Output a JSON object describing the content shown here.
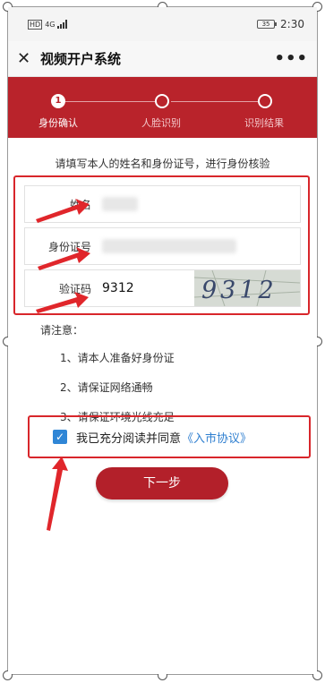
{
  "status_bar": {
    "network_badge": "HD",
    "network_type": "4G",
    "battery_level": "35",
    "time": "2:30"
  },
  "nav": {
    "close_icon": "close-icon",
    "title": "视频开户系统",
    "more_icon": "more-icon"
  },
  "steps": [
    {
      "number": "1",
      "label": "身份确认",
      "active": true
    },
    {
      "number": "",
      "label": "人脸识别",
      "active": false
    },
    {
      "number": "",
      "label": "识别结果",
      "active": false
    }
  ],
  "form": {
    "intro": "请填写本人的姓名和身份证号，进行身份核验",
    "name_label": "姓名",
    "id_label": "身份证号",
    "captcha_label": "验证码",
    "captcha_value": "9312",
    "captcha_image_text": "9312"
  },
  "notice": {
    "title": "请注意：",
    "items": [
      "1、请本人准备好身份证",
      "2、请保证网络通畅",
      "3、请保证环境光线充足"
    ]
  },
  "agreement": {
    "checked": true,
    "text": "我已充分阅读并同意",
    "link": "《入市协议》"
  },
  "next_button": "下一步",
  "colors": {
    "brand_red": "#b9232b",
    "highlight_red": "#d8262b",
    "link_blue": "#2f7fd0",
    "checkbox_blue": "#2f86d6"
  }
}
